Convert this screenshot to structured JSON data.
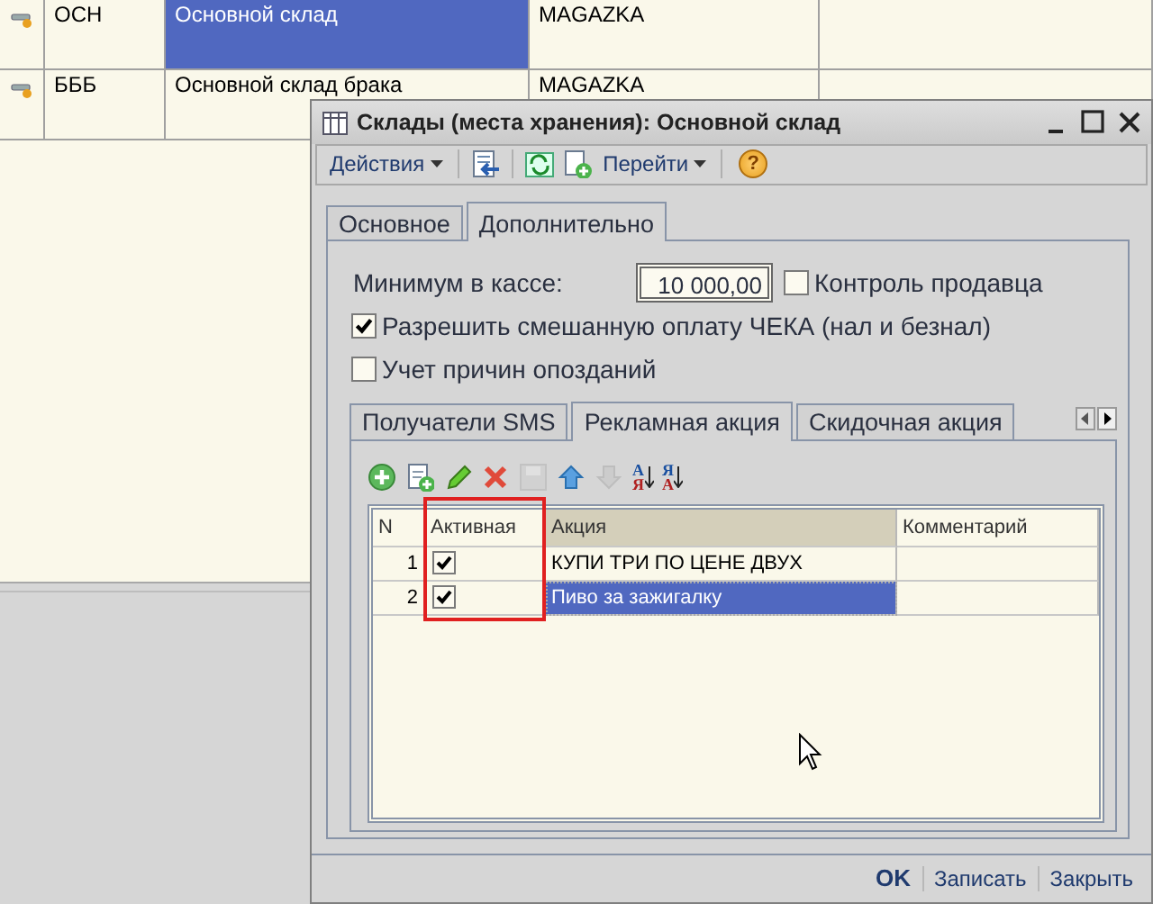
{
  "list": {
    "rows": [
      {
        "code": "ОСН",
        "name": "Основной склад",
        "org": "MAGAZKA",
        "selected": true
      },
      {
        "code": "БББ",
        "name": "Основной склад брака",
        "org": "MAGAZKA",
        "selected": false
      }
    ]
  },
  "dialog": {
    "title": "Склады (места хранения): Основной склад",
    "toolbar": [
      {
        "kind": "menu",
        "label": "Действия"
      },
      {
        "kind": "sep"
      },
      {
        "kind": "doc-arrow"
      },
      {
        "kind": "sep"
      },
      {
        "kind": "refresh"
      },
      {
        "kind": "doc-plus"
      },
      {
        "kind": "menu",
        "label": "Перейти"
      },
      {
        "kind": "sep"
      },
      {
        "kind": "help",
        "label": "?"
      }
    ],
    "tabs": [
      {
        "label": "Основное",
        "selected": false
      },
      {
        "label": "Дополнительно",
        "selected": true
      }
    ],
    "min_cash": {
      "label": "Минимум в кассе:",
      "value": "10 000,00"
    },
    "checks": [
      {
        "label": "Контроль продавца",
        "checked": false
      },
      {
        "label": "Разрешить смешанную оплату ЧЕКА (нал и безнал)",
        "checked": true
      },
      {
        "label": "Учет причин опозданий",
        "checked": false
      }
    ],
    "subtabs": [
      {
        "label": "Получатели SMS",
        "selected": false
      },
      {
        "label": "Рекламная акция",
        "selected": true
      },
      {
        "label": "Скидочная акция",
        "selected": false
      }
    ],
    "grid_tools": [
      {
        "kind": "add",
        "disabled": false
      },
      {
        "kind": "copy",
        "disabled": false
      },
      {
        "kind": "edit",
        "disabled": false
      },
      {
        "kind": "delete",
        "disabled": false
      },
      {
        "kind": "save",
        "disabled": true
      },
      {
        "kind": "up",
        "disabled": false
      },
      {
        "kind": "down",
        "disabled": true
      },
      {
        "kind": "sort",
        "letters": [
          "А",
          "Я"
        ],
        "disabled": false
      },
      {
        "kind": "sort",
        "letters": [
          "Я",
          "А"
        ],
        "disabled": false
      }
    ],
    "grid": {
      "columns": [
        {
          "label": "N",
          "highlighted": false,
          "sorted": false
        },
        {
          "label": "Активная",
          "highlighted": true,
          "sorted": false
        },
        {
          "label": "Акция",
          "highlighted": false,
          "sorted": true
        },
        {
          "label": "Комментарий",
          "highlighted": false,
          "sorted": false
        }
      ],
      "rows": [
        {
          "n": "1",
          "active": true,
          "action": "КУПИ ТРИ ПО ЦЕНЕ ДВУХ",
          "selected": false
        },
        {
          "n": "2",
          "active": true,
          "action": "Пиво за зажигалку",
          "selected": true
        }
      ]
    },
    "buttons": [
      {
        "label": "OK",
        "default": true
      },
      {
        "label": "Записать",
        "default": false
      },
      {
        "label": "Закрыть",
        "default": false
      }
    ]
  }
}
